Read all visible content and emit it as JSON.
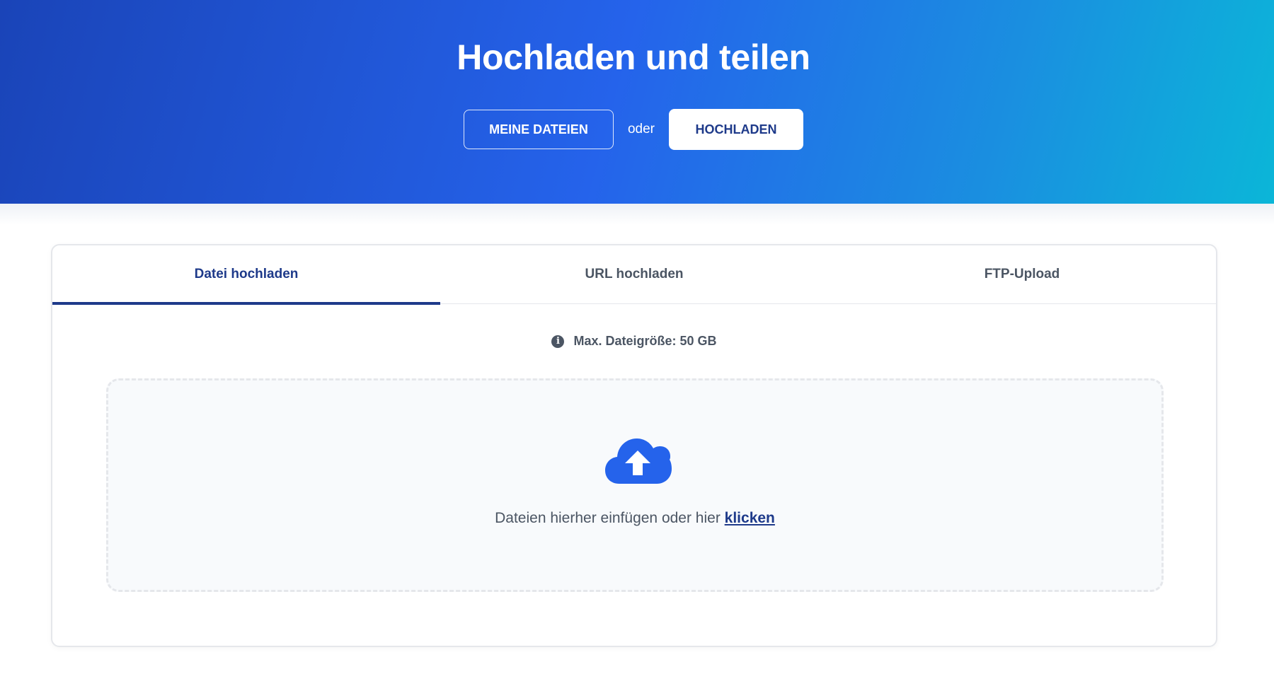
{
  "hero": {
    "title": "Hochladen und teilen",
    "my_files_label": "MEINE DATEIEN",
    "or_label": "oder",
    "upload_label": "HOCHLADEN"
  },
  "tabs": [
    {
      "label": "Datei hochladen",
      "active": true
    },
    {
      "label": "URL hochladen",
      "active": false
    },
    {
      "label": "FTP-Upload",
      "active": false
    }
  ],
  "upload": {
    "info_icon": "info-icon",
    "max_size_label": "Max. Dateigröße: 50 GB",
    "cloud_icon": "cloud-upload-icon",
    "drop_text": "Dateien hierher einfügen oder hier",
    "click_link": "klicken"
  },
  "colors": {
    "brand_blue": "#2563eb",
    "dark_blue": "#1e3a8a",
    "gradient_end": "#0bb6d8"
  }
}
